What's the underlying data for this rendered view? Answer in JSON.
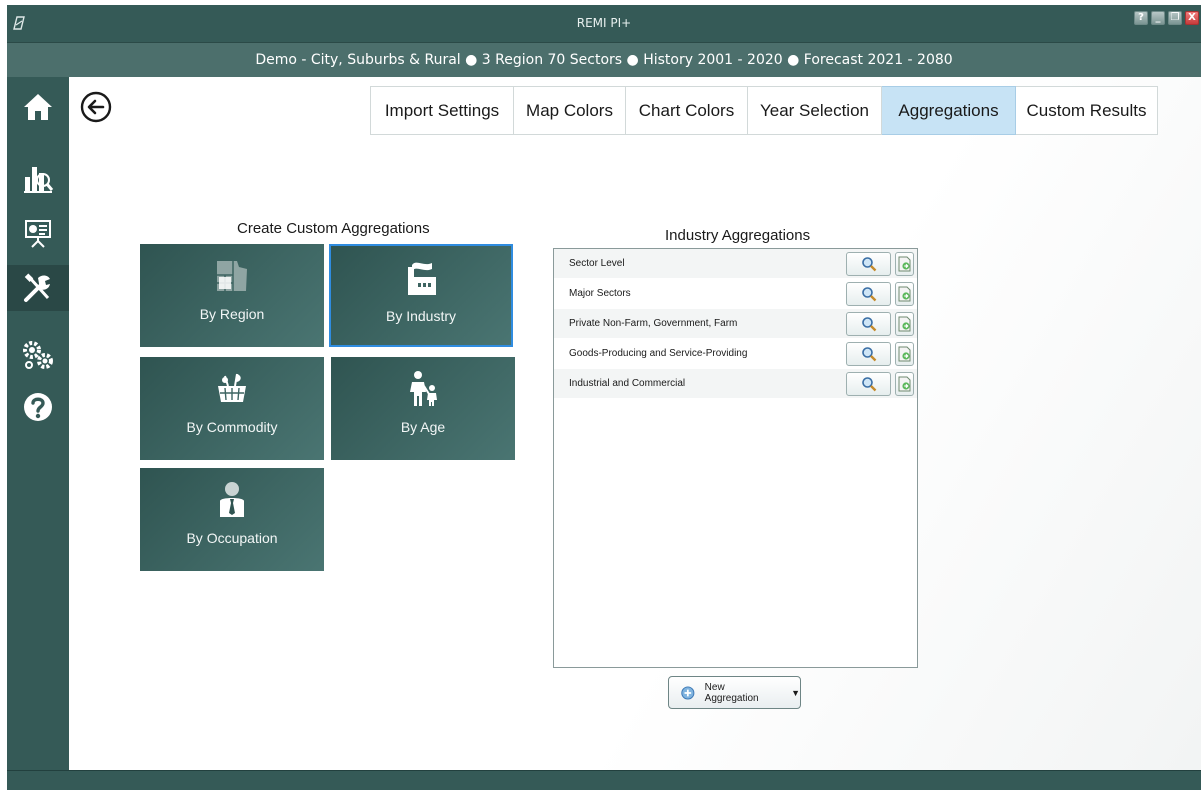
{
  "window": {
    "title": "REMI PI+",
    "buttons": {
      "help": "?",
      "minimize": "_",
      "restore": "❐",
      "close": "X"
    }
  },
  "model_bar": {
    "text": "Demo - City, Suburbs & Rural ● 3 Region 70 Sectors ● History 2001 - 2020 ● Forecast 2021 - 2080"
  },
  "sidenav": {
    "items": [
      {
        "icon": "home-icon"
      },
      {
        "icon": "analysis-chart-icon"
      },
      {
        "icon": "presentation-icon"
      },
      {
        "icon": "tools-icon",
        "active": true
      },
      {
        "icon": "gears-icon"
      },
      {
        "icon": "help-icon"
      }
    ]
  },
  "tabs": [
    {
      "label": "Import Settings"
    },
    {
      "label": "Map Colors"
    },
    {
      "label": "Chart Colors"
    },
    {
      "label": "Year Selection"
    },
    {
      "label": "Aggregations",
      "active": true
    },
    {
      "label": "Custom Results"
    }
  ],
  "create": {
    "title": "Create Custom Aggregations",
    "tiles": [
      {
        "label": "By Region",
        "icon": "region-map-icon"
      },
      {
        "label": "By Industry",
        "icon": "factory-icon",
        "selected": true
      },
      {
        "label": "By Commodity",
        "icon": "basket-icon"
      },
      {
        "label": "By Age",
        "icon": "parent-child-icon"
      },
      {
        "label": "By Occupation",
        "icon": "worker-icon"
      }
    ]
  },
  "industry": {
    "title": "Industry Aggregations",
    "rows": [
      {
        "label": "Sector Level"
      },
      {
        "label": "Major Sectors"
      },
      {
        "label": "Private Non-Farm, Government, Farm"
      },
      {
        "label": "Goods-Producing and Service-Providing"
      },
      {
        "label": "Industrial and Commercial"
      }
    ],
    "new_button": "New Aggregation"
  },
  "colors": {
    "titlebar": "#355a57",
    "modelbar": "#4c6f6c",
    "tile": "#3d6461",
    "active_tab": "#c7e3f5",
    "selected_border": "#2f8ce0"
  }
}
